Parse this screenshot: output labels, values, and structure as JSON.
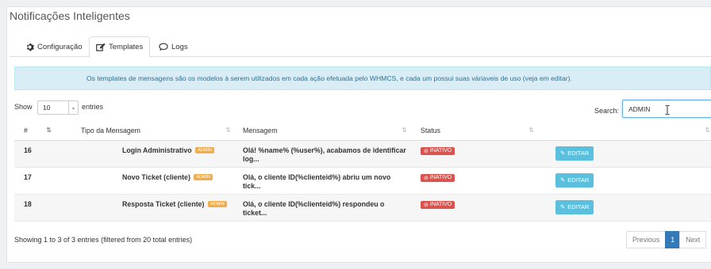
{
  "page_title": "Notificações Inteligentes",
  "tabs": [
    {
      "label": "Configuração",
      "icon": "gear-icon"
    },
    {
      "label": "Templates",
      "icon": "edit-icon"
    },
    {
      "label": "Logs",
      "icon": "comment-icon"
    }
  ],
  "alert_text": "Os templates de mensagens são os modelos à serem utilizados em cada ação efetuada pelo WHMCS, e cada um possui suas váriaveis de uso (veja em editar).",
  "length": {
    "show_label": "Show",
    "value": "10",
    "entries_label": "entries"
  },
  "search": {
    "label": "Search:",
    "value": "ADMIN"
  },
  "table": {
    "headers": [
      "#",
      "Tipo da Mensagem",
      "Mensagem",
      "Status",
      ""
    ],
    "rows": [
      {
        "id": "16",
        "tipo": "Login Administrativo",
        "badge": "ADMIN",
        "mensagem": "Olá! %name% (%user%), acabamos de identificar log...",
        "status": "INATIVO",
        "action": "EDITAR"
      },
      {
        "id": "17",
        "tipo": "Novo Ticket (cliente)",
        "badge": "ADMIN",
        "mensagem": "Olá, o cliente ID(%clienteid%) abriu um novo tick...",
        "status": "INATIVO",
        "action": "EDITAR"
      },
      {
        "id": "18",
        "tipo": "Resposta Ticket (cliente)",
        "badge": "ADMIN",
        "mensagem": "Olá, o cliente ID(%clienteid%) respondeu o ticket...",
        "status": "INATIVO",
        "action": "EDITAR"
      }
    ]
  },
  "info_text": "Showing 1 to 3 of 3 entries (filtered from 20 total entries)",
  "pagination": {
    "previous": "Previous",
    "current": "1",
    "next": "Next"
  },
  "colors": {
    "info_bg": "#d9edf7",
    "admin_badge": "#f0ad4e",
    "inactive_badge": "#d9534f",
    "edit_button": "#5bc0de",
    "page_active": "#337ab7"
  }
}
